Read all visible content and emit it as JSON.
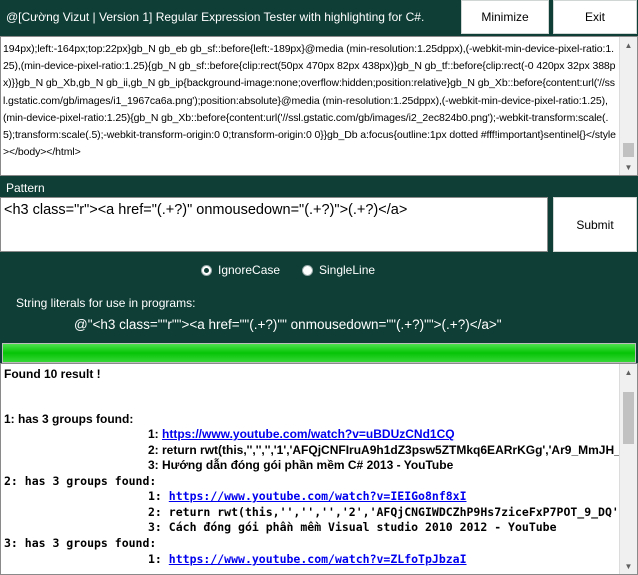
{
  "window": {
    "title": "@[Cường Vizut | Version 1] Regular Expression Tester with highlighting for C#.",
    "minimize_label": "Minimize",
    "exit_label": "Exit"
  },
  "source": {
    "text": "194px);left:-164px;top:22px}gb_N gb_eb gb_sf::before{left:-189px}@media (min-resolution:1.25dppx),(-webkit-min-device-pixel-ratio:1.25),(min-device-pixel-ratio:1.25){gb_N gb_sf::before{clip:rect(50px 470px 82px 438px)}gb_N gb_tf::before{clip:rect(-0 420px 32px 388px)}}gb_N gb_Xb,gb_N gb_ii,gb_N gb_ip{background-image:none;overflow:hidden;position:relative}gb_N gb_Xb::before{content:url('//ssl.gstatic.com/gb/images/i1_1967ca6a.png');position:absolute}@media (min-resolution:1.25dppx),(-webkit-min-device-pixel-ratio:1.25),(min-device-pixel-ratio:1.25){gb_N gb_Xb::before{content:url('//ssl.gstatic.com/gb/images/i2_2ec824b0.png');-webkit-transform:scale(.5);transform:scale(.5);-webkit-transform-origin:0 0;transform-origin:0 0}}gb_Db a:focus{outline:1px dotted #fff!important}sentinel{}</style></body></html>"
  },
  "pattern": {
    "label": "Pattern",
    "value": "<h3 class=\"r\"><a href=\"(.+?)\" onmousedown=\"(.+?)\">(.+?)</a>",
    "submit_label": "Submit"
  },
  "options": {
    "ignore_case_label": "IgnoreCase",
    "single_line_label": "SingleLine",
    "ignore_case_checked": true,
    "single_line_checked": false
  },
  "literal": {
    "label": "String literals for use in programs:",
    "value": "@\"<h3 class=\"\"r\"\"><a href=\"\"(.+?)\"\" onmousedown=\"\"(.+?)\"\">(.+?)</a>\""
  },
  "progress": {
    "fraction": 1.0
  },
  "results": {
    "summary": "Found 10 result !",
    "matches": [
      {
        "header": "1: has 3 groups found:",
        "g1_num": "1:",
        "g1": "https://www.youtube.com/watch?v=uBDUzCNd1CQ",
        "g2_num": "2:",
        "g2": "return rwt(this,'','','','1','AFQjCNFIruA9h1dZ3psw5ZTMkq6EARrKGg','Ar9_MmJH_v",
        "g3_num": "3:",
        "g3": "Hướng dẫn đóng gói phần mềm C# 2013 - YouTube"
      },
      {
        "header": "2: has 3 groups found:",
        "g1_num": "1:",
        "g1": "https://www.youtube.com/watch?v=IEIGo8nf8xI",
        "g2_num": "2:",
        "g2": "return rwt(this,'','','','2','AFQjCNGIWDCZhP9Hs7ziceFxP7POT_9_DQ','2r-9WfKm",
        "g3_num": "3:",
        "g3": "Cách đóng gói phần mềm Visual studio 2010 2012 - YouTube"
      },
      {
        "header": "3: has 3 groups found:",
        "g1_num": "1:",
        "g1": "https://www.youtube.com/watch?v=ZLfoTpJbzaI"
      }
    ]
  },
  "colors": {
    "background": "#0f3e36",
    "progress": "#06c406",
    "link": "#0000ee"
  }
}
